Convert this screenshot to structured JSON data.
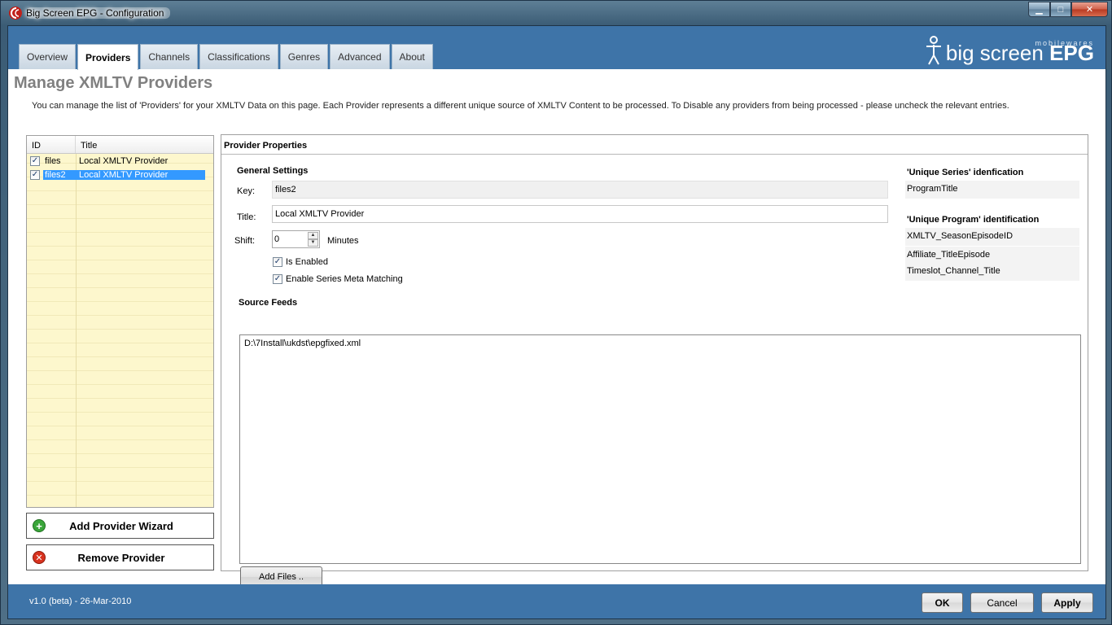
{
  "window": {
    "title": "Big Screen EPG - Configuration",
    "controls": {
      "minimize": "▁",
      "maximize": "□",
      "close": "✕"
    }
  },
  "tabs": [
    {
      "label": "Overview"
    },
    {
      "label": "Providers",
      "active": true
    },
    {
      "label": "Channels"
    },
    {
      "label": "Classifications"
    },
    {
      "label": "Genres"
    },
    {
      "label": "Advanced"
    },
    {
      "label": "About"
    }
  ],
  "logo": {
    "small": "mobilewares",
    "main": "big screen ",
    "bold": "EPG"
  },
  "page": {
    "title": "Manage XMLTV Providers",
    "description": "You can manage the list of 'Providers' for your XMLTV Data on this page. Each Provider represents a different unique source of XMLTV Content to be processed.  To Disable any providers from being processed - please uncheck the relevant entries."
  },
  "provider_list": {
    "headers": {
      "id": "ID",
      "title": "Title"
    },
    "rows": [
      {
        "checked": true,
        "id": "files",
        "title": "Local XMLTV Provider",
        "selected": false
      },
      {
        "checked": true,
        "id": "files2",
        "title": "Local XMLTV Provider",
        "selected": true
      }
    ]
  },
  "buttons": {
    "add_provider": "Add Provider Wizard",
    "remove_provider": "Remove Provider",
    "add_files": "Add Files ..",
    "ok": "OK",
    "cancel": "Cancel",
    "apply": "Apply"
  },
  "properties": {
    "header": "Provider Properties",
    "general_settings": "General Settings",
    "key_label": "Key:",
    "key_value": "files2",
    "title_label": "Title:",
    "title_value": "Local XMLTV Provider",
    "shift_label": "Shift:",
    "shift_value": "0",
    "shift_unit": "Minutes",
    "is_enabled_label": "Is Enabled",
    "is_enabled": true,
    "series_meta_label": "Enable Series Meta Matching",
    "series_meta": true,
    "source_feeds_label": "Source Feeds",
    "source_feeds": [
      "D:\\7Install\\ukdst\\epgfixed.xml"
    ],
    "unique_series_label": "'Unique Series' idenfication",
    "unique_series": [
      "ProgramTitle"
    ],
    "unique_program_label": "'Unique Program' identification",
    "unique_program": [
      "XMLTV_SeasonEpisodeID",
      "Affiliate_TitleEpisode",
      "Timeslot_Channel_Title"
    ]
  },
  "footer": {
    "version": "v1.0 (beta) - 26-Mar-2010"
  },
  "colors": {
    "band": "#3e74a8",
    "selection": "#3399ff",
    "list_bg": "#fdf7cd"
  }
}
